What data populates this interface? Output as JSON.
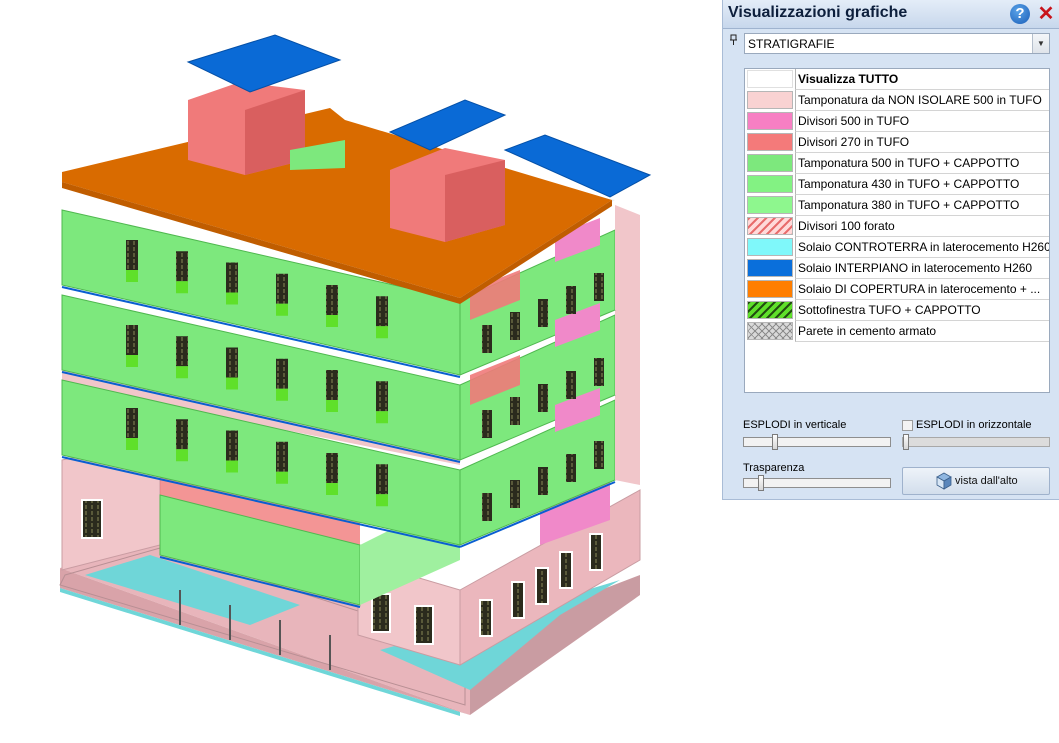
{
  "panel": {
    "title": "Visualizzazioni grafiche",
    "help_icon": "help-icon",
    "close_icon": "close-icon",
    "dropdown_value": "STRATIGRAFIE",
    "layers": [
      {
        "label": "Visualizza TUTTO",
        "color": "#ffffff",
        "pattern": "none"
      },
      {
        "label": "Tamponatura da NON ISOLARE 500 in TUFO",
        "color": "#f9d2d2",
        "pattern": "none"
      },
      {
        "label": "Divisori 500 in  TUFO",
        "color": "#f77fc3",
        "pattern": "none"
      },
      {
        "label": "Divisori 270 in  TUFO",
        "color": "#f47a7a",
        "pattern": "none"
      },
      {
        "label": "Tamponatura 500 in TUFO + CAPPOTTO",
        "color": "#7de87d",
        "pattern": "none"
      },
      {
        "label": "Tamponatura 430 in TUFO + CAPPOTTO",
        "color": "#83f283",
        "pattern": "none"
      },
      {
        "label": "Tamponatura 380 in TUFO + CAPPOTTO",
        "color": "#8ef78e",
        "pattern": "none"
      },
      {
        "label": "Divisori 100 forato",
        "color": "#ffdada",
        "pattern": "hatch-red"
      },
      {
        "label": "Solaio CONTROTERRA in laterocemento H260",
        "color": "#7ff8fa",
        "pattern": "none"
      },
      {
        "label": "Solaio INTERPIANO in laterocemento H260",
        "color": "#0a6fdb",
        "pattern": "none"
      },
      {
        "label": "Solaio  DI COPERTURA  in laterocemento + ...",
        "color": "#ff7e00",
        "pattern": "none"
      },
      {
        "label": "Sottofinestra TUFO + CAPPOTTO",
        "color": "#5fe02a",
        "pattern": "hatch-dark"
      },
      {
        "label": "Parete in cemento armato",
        "color": "#d9d9d9",
        "pattern": "crosshatch"
      }
    ],
    "explode_vertical_label": "ESPLODI in verticale",
    "explode_horizontal_label": "ESPLODI in orizzontale",
    "transparency_label": "Trasparenza",
    "explode_vertical_value": 0.2,
    "explode_horizontal_value": 0.0,
    "explode_horizontal_checked": false,
    "transparency_value": 0.1,
    "top_view_label": "vista dall'alto",
    "top_view_icon": "cube-icon"
  },
  "model": {
    "name": "building-3d-model",
    "colors": {
      "roof_slab": "#d96b00",
      "roof_panel": "#0a6ad6",
      "wall_green": "#7de87d",
      "wall_pink": "#f1bfc4",
      "partition_red": "#f07a7a",
      "partition_magenta": "#f089c9",
      "ground_slab": "#6fd6d8"
    }
  }
}
